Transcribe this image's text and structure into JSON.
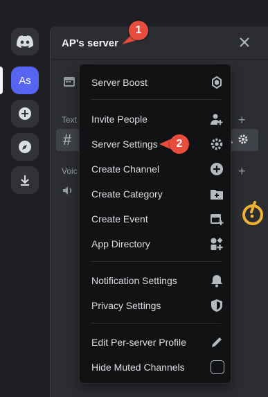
{
  "server": {
    "name": "AP's server"
  },
  "rail": {
    "active_label": "As"
  },
  "channels": {
    "text_category": "Text",
    "voice_category": "Voic"
  },
  "menu": {
    "items": [
      {
        "label": "Server Boost",
        "icon": "boost-icon"
      },
      {
        "label": "Invite People",
        "icon": "invite-people-icon"
      },
      {
        "label": "Server Settings",
        "icon": "gear-icon"
      },
      {
        "label": "Create Channel",
        "icon": "plus-circle-icon"
      },
      {
        "label": "Create Category",
        "icon": "folder-plus-icon"
      },
      {
        "label": "Create Event",
        "icon": "calendar-plus-icon"
      },
      {
        "label": "App Directory",
        "icon": "app-directory-icon"
      },
      {
        "label": "Notification Settings",
        "icon": "bell-icon"
      },
      {
        "label": "Privacy Settings",
        "icon": "shield-icon"
      },
      {
        "label": "Edit Per-server Profile",
        "icon": "pencil-icon"
      },
      {
        "label": "Hide Muted Channels",
        "icon": "checkbox-icon",
        "checked": false
      }
    ]
  },
  "annotations": {
    "badge_1": "1",
    "badge_2": "2"
  },
  "colors": {
    "accent": "#5865f2",
    "badge": "#e84c3d",
    "warning": "#f0b232"
  }
}
